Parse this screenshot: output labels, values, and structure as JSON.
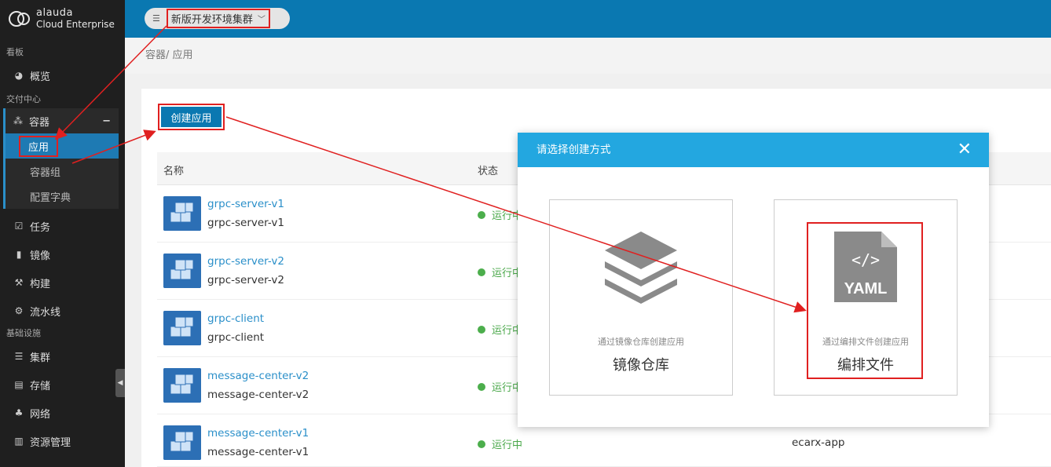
{
  "logo": {
    "line1": "alauda",
    "line2": "Cloud Enterprise"
  },
  "sidebar": {
    "section1": "看板",
    "overview": "概览",
    "section2": "交付中心",
    "containers": "容器",
    "collapse_symbol": "−",
    "sub": [
      "应用",
      "容器组",
      "配置字典"
    ],
    "items2": [
      "任务",
      "镜像",
      "构建",
      "流水线"
    ],
    "section3": "基础设施",
    "items3": [
      "集群",
      "存储",
      "网络",
      "资源管理"
    ]
  },
  "topbar": {
    "cluster": "新版开发环境集群"
  },
  "breadcrumb": "容器/ 应用",
  "create_button": "创建应用",
  "table": {
    "col_name": "名称",
    "col_status": "状态",
    "rows": [
      {
        "link": "grpc-server-v1",
        "sub": "grpc-server-v1",
        "status": "运行中",
        "space": ""
      },
      {
        "link": "grpc-server-v2",
        "sub": "grpc-server-v2",
        "status": "运行中",
        "space": ""
      },
      {
        "link": "grpc-client",
        "sub": "grpc-client",
        "status": "运行中",
        "space": ""
      },
      {
        "link": "message-center-v2",
        "sub": "message-center-v2",
        "status": "运行中",
        "space": ""
      },
      {
        "link": "message-center-v1",
        "sub": "message-center-v1",
        "status": "运行中",
        "space": "ecarx-app"
      }
    ]
  },
  "modal": {
    "title": "请选择创建方式",
    "close": "✕",
    "option1": {
      "desc": "通过镜像仓库创建应用",
      "title": "镜像仓库"
    },
    "option2": {
      "desc": "通过编排文件创建应用",
      "title": "编排文件",
      "badge": "YAML",
      "code": "</>"
    }
  },
  "colors": {
    "accent": "#0a78b1",
    "modal_header": "#23a7e0",
    "annotation": "#e02020"
  }
}
